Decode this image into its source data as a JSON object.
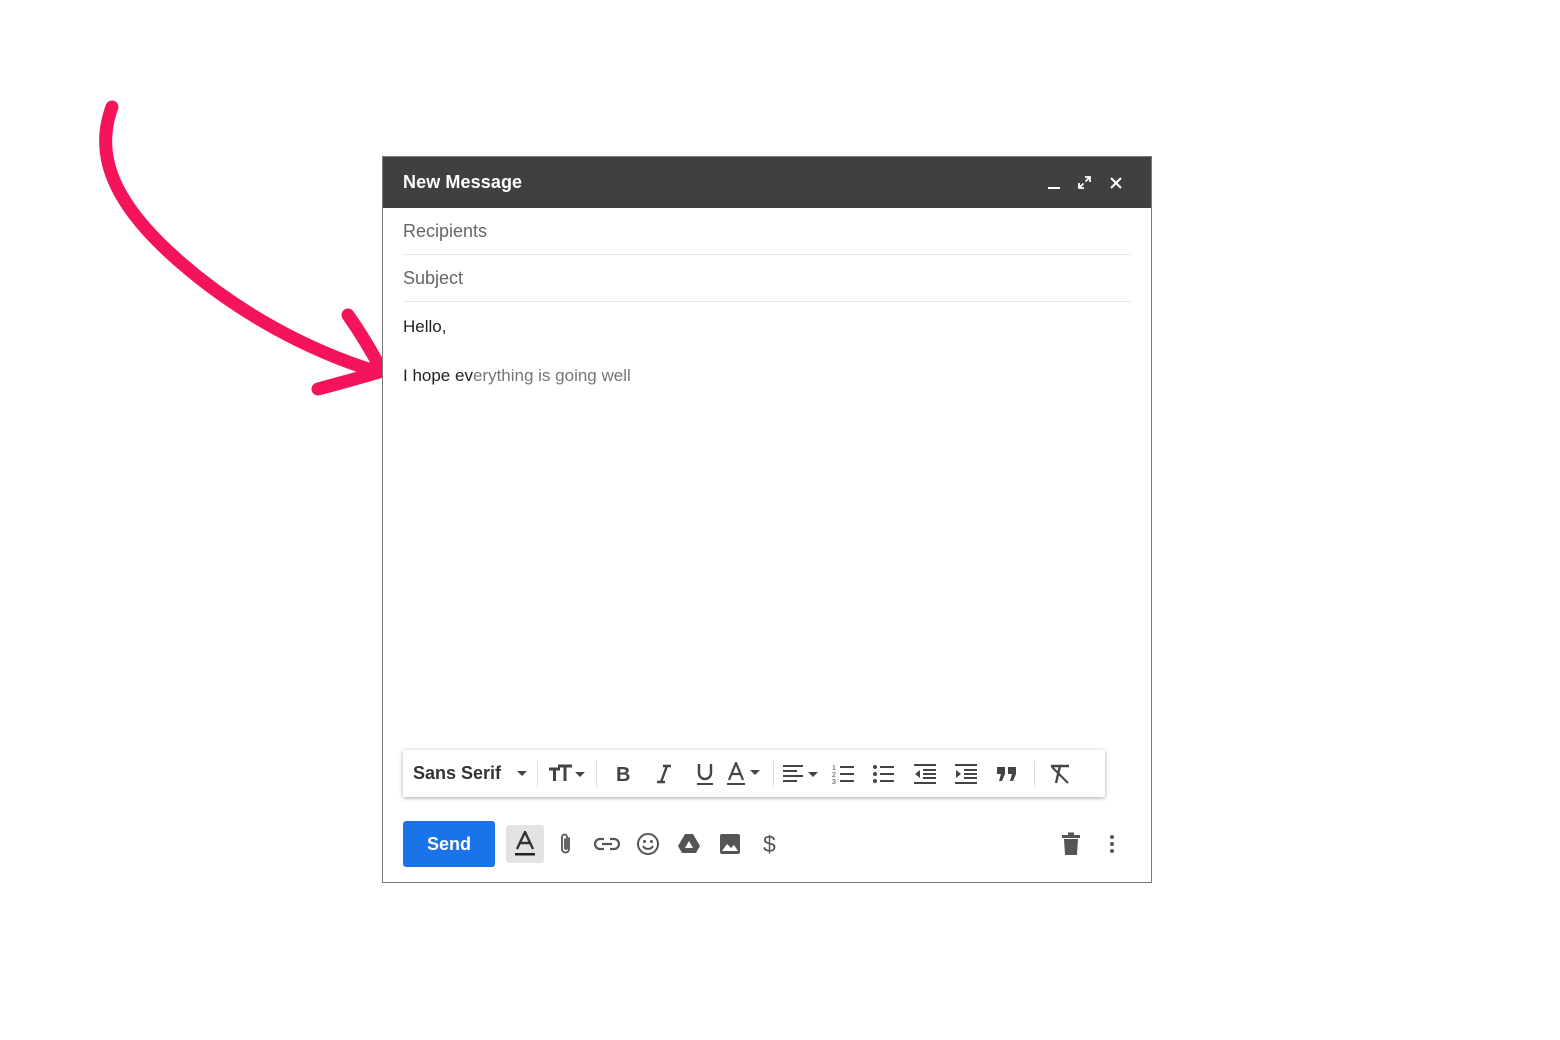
{
  "compose": {
    "title": "New Message",
    "recipients_placeholder": "Recipients",
    "subject_placeholder": "Subject",
    "body": {
      "line1": "Hello,",
      "line2_typed": "I hope ev",
      "line2_suggestion": "erything is going well"
    }
  },
  "header_buttons": [
    "minimize-icon",
    "fullscreen-icon",
    "close-icon"
  ],
  "format_bar": {
    "font": "Sans Serif",
    "buttons": [
      "text-size-icon",
      "bold-icon",
      "italic-icon",
      "underline-icon",
      "text-color-icon",
      "align-icon",
      "numbered-list-icon",
      "bulleted-list-icon",
      "indent-less-icon",
      "indent-more-icon",
      "quote-icon",
      "remove-formatting-icon"
    ]
  },
  "bottom_bar": {
    "send_label": "Send",
    "buttons": [
      "formatting-options-icon",
      "attach-icon",
      "link-icon",
      "emoji-icon",
      "drive-icon",
      "photo-icon",
      "money-icon",
      "trash-icon",
      "more-options-icon"
    ]
  },
  "colors": {
    "header_bg": "#404040",
    "send_button": "#1a73e8",
    "arrow": "#f5145a"
  }
}
